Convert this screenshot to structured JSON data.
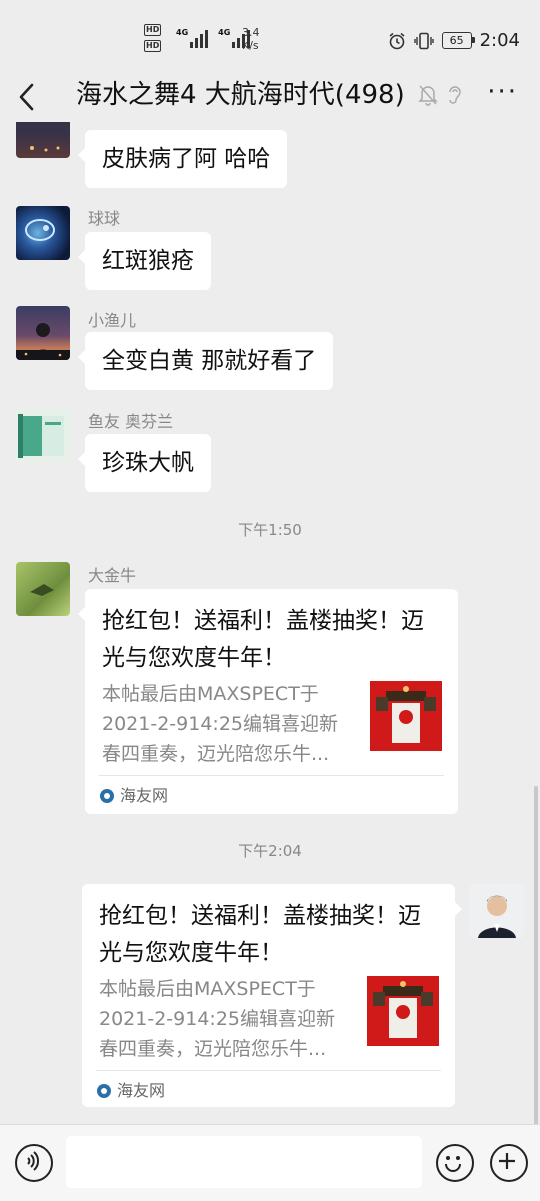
{
  "status_bar": {
    "hd1": "HD",
    "hd2": "HD",
    "net1": "4G",
    "net2": "4G",
    "speed_value": "3.4",
    "speed_unit": "K/s",
    "battery": "65",
    "time": "2:04"
  },
  "header": {
    "title": "海水之舞4 大航海时代(498)",
    "more": "···"
  },
  "messages": [
    {
      "sender": "",
      "text": "皮肤病了阿 哈哈"
    },
    {
      "sender": "球球",
      "text": "红斑狼疮"
    },
    {
      "sender": "小渔儿",
      "text": "全变白黄 那就好看了"
    },
    {
      "sender": "鱼友 奥芬兰",
      "text": "珍珠大帆"
    }
  ],
  "timestamps": [
    "下午1:50",
    "下午2:04"
  ],
  "cards": [
    {
      "sender": "大金牛",
      "title": "抢红包！送福利！盖楼抽奖！迈光与您欢度牛年！",
      "desc": "本帖最后由MAXSPECT于2021-2-914:25编辑喜迎新春四重奏，迈光陪您乐牛...",
      "source": "海友网"
    },
    {
      "sender": "",
      "title": "抢红包！送福利！盖楼抽奖！迈光与您欢度牛年！",
      "desc": "本帖最后由MAXSPECT于2021-2-914:25编辑喜迎新春四重奏，迈光陪您乐牛...",
      "source": "海友网"
    }
  ],
  "input": {
    "placeholder": ""
  },
  "colors": {
    "background": "#ededed",
    "bubble": "#ffffff",
    "meta_text": "#888888",
    "thumb_red": "#d01a1a"
  },
  "icons": [
    "back-arrow-icon",
    "mute-bell-icon",
    "ear-icon",
    "more-icon",
    "voice-icon",
    "emoji-icon",
    "plus-icon",
    "alarm-icon",
    "vibrate-icon"
  ]
}
